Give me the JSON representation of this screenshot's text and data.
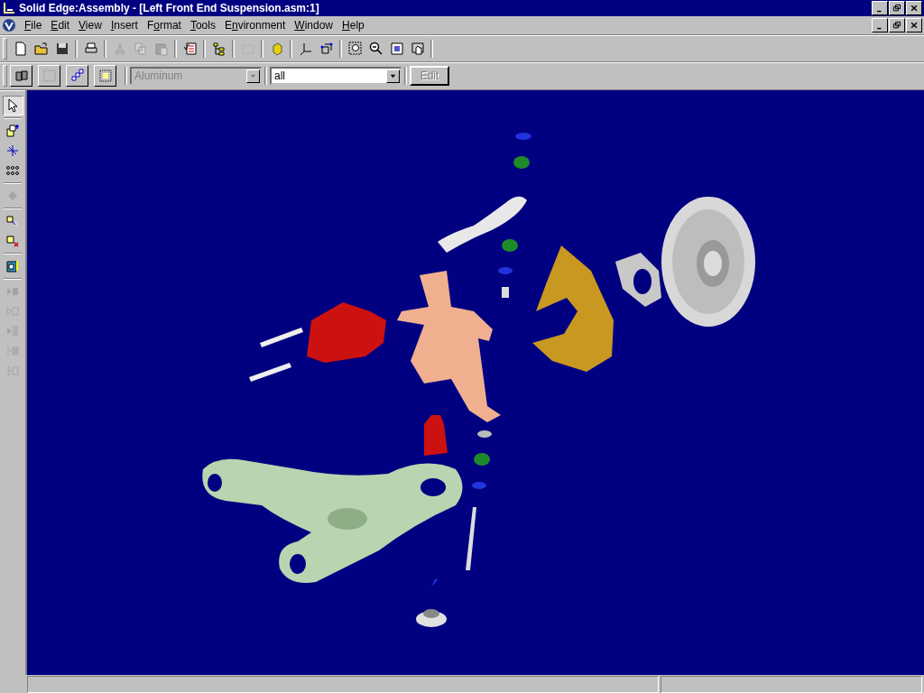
{
  "window": {
    "title": "Solid Edge:Assembly - [Left Front End Suspension.asm:1]"
  },
  "menu": [
    {
      "key": "F",
      "after": "ile"
    },
    {
      "key": "E",
      "after": "dit"
    },
    {
      "key": "V",
      "after": "iew"
    },
    {
      "key": "I",
      "after": "nsert"
    },
    {
      "before": "F",
      "key": "o",
      "after": "rmat"
    },
    {
      "key": "T",
      "after": "ools"
    },
    {
      "before": "E",
      "key": "n",
      "after": "vironment"
    },
    {
      "key": "W",
      "after": "indow"
    },
    {
      "key": "H",
      "after": "elp"
    }
  ],
  "properties_bar": {
    "material": {
      "value": "Aluminum",
      "disabled": true
    },
    "filter": {
      "value": "all",
      "disabled": false
    },
    "edit_button": {
      "label": "Edit",
      "disabled": true
    }
  }
}
